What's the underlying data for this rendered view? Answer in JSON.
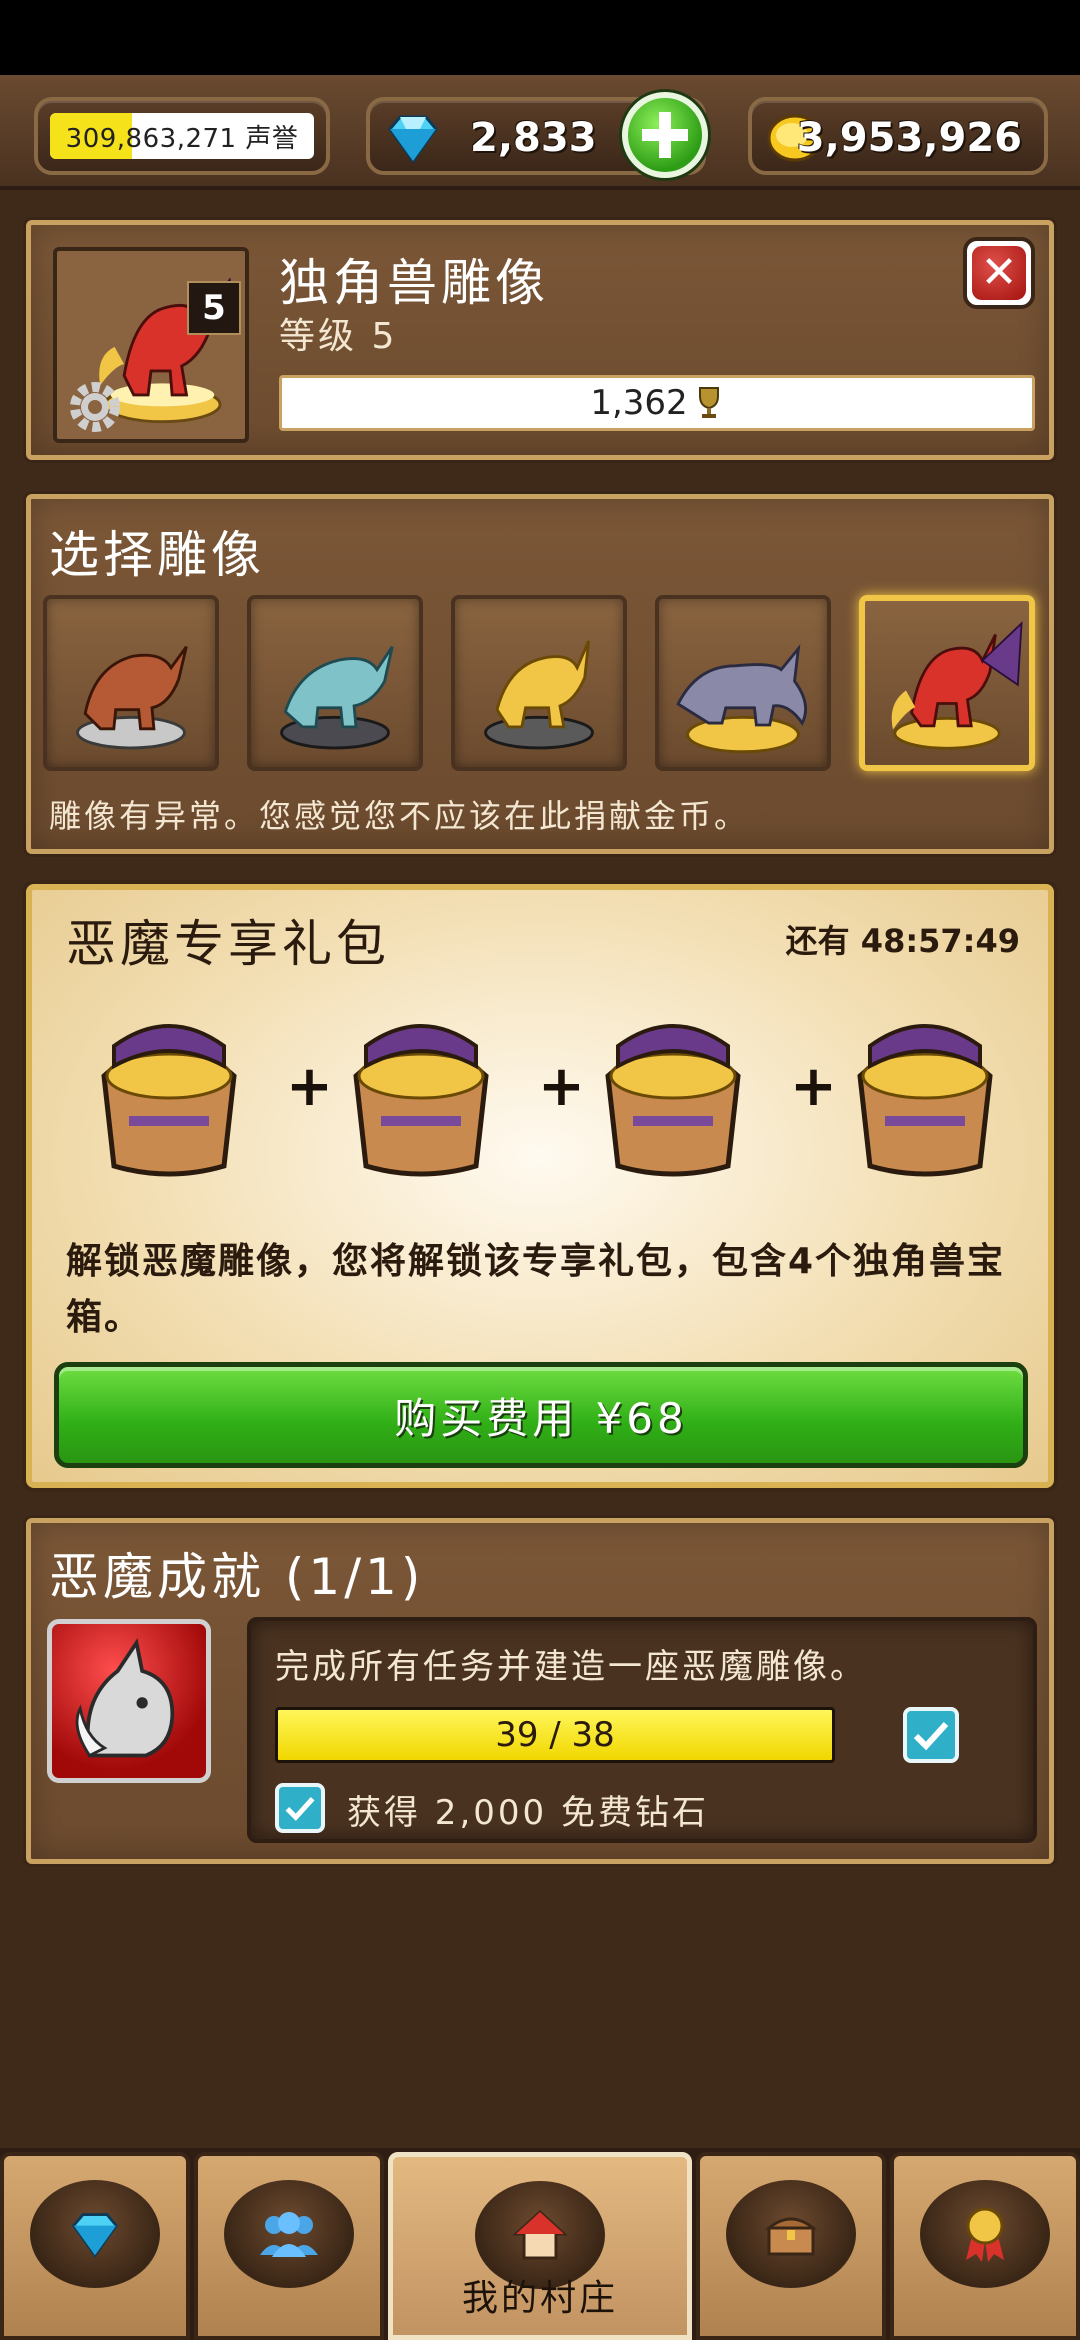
{
  "currency": {
    "reputation_fill": 0.31,
    "reputation_highlight": "309",
    "reputation_rest": ",863,271 声誉",
    "gems": "2,833",
    "gold": "3,953,926"
  },
  "statue": {
    "level_badge": "5",
    "title": "独角兽雕像",
    "level_text": "等级 5",
    "trophies": "1,362"
  },
  "select": {
    "title": "选择雕像",
    "note": "雕像有异常。您感觉您不应该在此捐献金币。",
    "selected_index": 4
  },
  "bundle": {
    "title": "恶魔专享礼包",
    "timer": "还有 48:57:49",
    "plus": "+",
    "description": "解锁恶魔雕像，您将解锁该专享礼包，包含4个独角兽宝箱。",
    "buy_label": "购买费用 ¥68"
  },
  "achievement": {
    "title": "恶魔成就 (1/1)",
    "description": "完成所有任务并建造一座恶魔雕像。",
    "progress_text": "39 / 38",
    "progress_fraction": 1.0,
    "reward_text": "获得 2,000 免费钻石"
  },
  "nav": {
    "tabs": [
      {
        "icon": "diamond-icon",
        "label": ""
      },
      {
        "icon": "people-icon",
        "label": ""
      },
      {
        "icon": "home-icon",
        "label": "我的村庄",
        "active": true
      },
      {
        "icon": "chest-icon",
        "label": ""
      },
      {
        "icon": "medal-icon",
        "label": ""
      }
    ]
  },
  "colors": {
    "accent_green": "#2fae16",
    "gold": "#f1c545",
    "wood": "#6b4a2e"
  }
}
